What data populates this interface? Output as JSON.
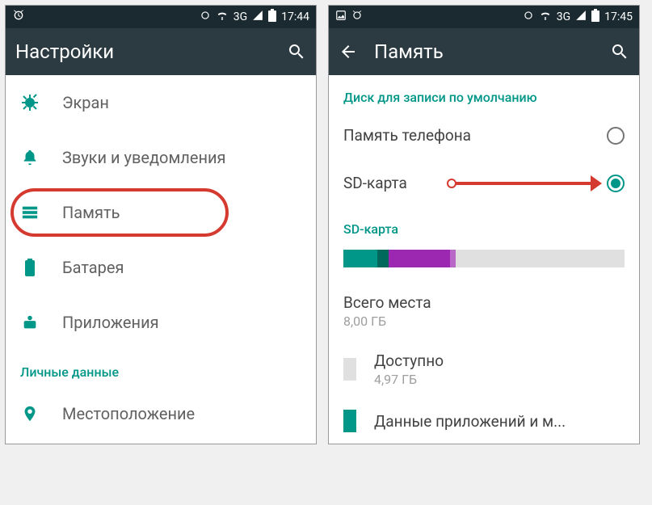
{
  "left": {
    "status": {
      "time": "17:44",
      "net": "3G"
    },
    "appbar": {
      "title": "Настройки"
    },
    "items": [
      {
        "label": "Экран"
      },
      {
        "label": "Звуки и уведомления"
      },
      {
        "label": "Память"
      },
      {
        "label": "Батарея"
      },
      {
        "label": "Приложения"
      }
    ],
    "section_personal": "Личные данные",
    "item_location": "Местоположение"
  },
  "right": {
    "status": {
      "time": "17:45",
      "net": "3G"
    },
    "appbar": {
      "title": "Память"
    },
    "section_default_disk": "Диск для записи по умолчанию",
    "radio_phone": "Память телефона",
    "radio_sd": "SD-карта",
    "section_sd": "SD-карта",
    "total": {
      "title": "Всего места",
      "value": "8,00 ГБ"
    },
    "avail": {
      "title": "Доступно",
      "value": "4,97 ГБ"
    },
    "apps": {
      "title": "Данные приложений и м..."
    }
  }
}
